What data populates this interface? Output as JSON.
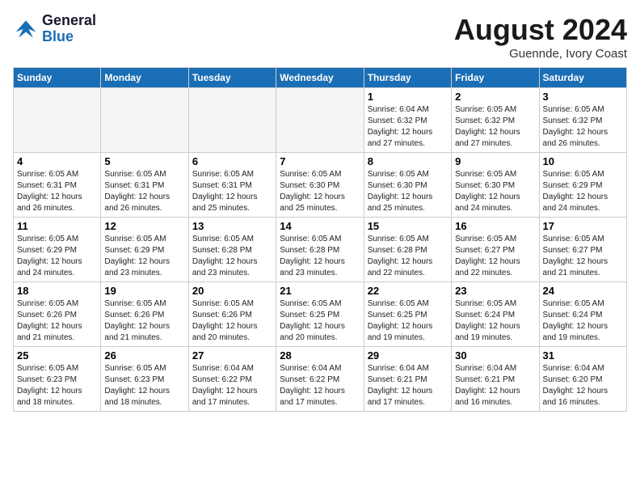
{
  "header": {
    "logo_line1": "General",
    "logo_line2": "Blue",
    "month": "August 2024",
    "location": "Guennde, Ivory Coast"
  },
  "weekdays": [
    "Sunday",
    "Monday",
    "Tuesday",
    "Wednesday",
    "Thursday",
    "Friday",
    "Saturday"
  ],
  "weeks": [
    [
      {
        "day": "",
        "info": ""
      },
      {
        "day": "",
        "info": ""
      },
      {
        "day": "",
        "info": ""
      },
      {
        "day": "",
        "info": ""
      },
      {
        "day": "1",
        "info": "Sunrise: 6:04 AM\nSunset: 6:32 PM\nDaylight: 12 hours\nand 27 minutes."
      },
      {
        "day": "2",
        "info": "Sunrise: 6:05 AM\nSunset: 6:32 PM\nDaylight: 12 hours\nand 27 minutes."
      },
      {
        "day": "3",
        "info": "Sunrise: 6:05 AM\nSunset: 6:32 PM\nDaylight: 12 hours\nand 26 minutes."
      }
    ],
    [
      {
        "day": "4",
        "info": "Sunrise: 6:05 AM\nSunset: 6:31 PM\nDaylight: 12 hours\nand 26 minutes."
      },
      {
        "day": "5",
        "info": "Sunrise: 6:05 AM\nSunset: 6:31 PM\nDaylight: 12 hours\nand 26 minutes."
      },
      {
        "day": "6",
        "info": "Sunrise: 6:05 AM\nSunset: 6:31 PM\nDaylight: 12 hours\nand 25 minutes."
      },
      {
        "day": "7",
        "info": "Sunrise: 6:05 AM\nSunset: 6:30 PM\nDaylight: 12 hours\nand 25 minutes."
      },
      {
        "day": "8",
        "info": "Sunrise: 6:05 AM\nSunset: 6:30 PM\nDaylight: 12 hours\nand 25 minutes."
      },
      {
        "day": "9",
        "info": "Sunrise: 6:05 AM\nSunset: 6:30 PM\nDaylight: 12 hours\nand 24 minutes."
      },
      {
        "day": "10",
        "info": "Sunrise: 6:05 AM\nSunset: 6:29 PM\nDaylight: 12 hours\nand 24 minutes."
      }
    ],
    [
      {
        "day": "11",
        "info": "Sunrise: 6:05 AM\nSunset: 6:29 PM\nDaylight: 12 hours\nand 24 minutes."
      },
      {
        "day": "12",
        "info": "Sunrise: 6:05 AM\nSunset: 6:29 PM\nDaylight: 12 hours\nand 23 minutes."
      },
      {
        "day": "13",
        "info": "Sunrise: 6:05 AM\nSunset: 6:28 PM\nDaylight: 12 hours\nand 23 minutes."
      },
      {
        "day": "14",
        "info": "Sunrise: 6:05 AM\nSunset: 6:28 PM\nDaylight: 12 hours\nand 23 minutes."
      },
      {
        "day": "15",
        "info": "Sunrise: 6:05 AM\nSunset: 6:28 PM\nDaylight: 12 hours\nand 22 minutes."
      },
      {
        "day": "16",
        "info": "Sunrise: 6:05 AM\nSunset: 6:27 PM\nDaylight: 12 hours\nand 22 minutes."
      },
      {
        "day": "17",
        "info": "Sunrise: 6:05 AM\nSunset: 6:27 PM\nDaylight: 12 hours\nand 21 minutes."
      }
    ],
    [
      {
        "day": "18",
        "info": "Sunrise: 6:05 AM\nSunset: 6:26 PM\nDaylight: 12 hours\nand 21 minutes."
      },
      {
        "day": "19",
        "info": "Sunrise: 6:05 AM\nSunset: 6:26 PM\nDaylight: 12 hours\nand 21 minutes."
      },
      {
        "day": "20",
        "info": "Sunrise: 6:05 AM\nSunset: 6:26 PM\nDaylight: 12 hours\nand 20 minutes."
      },
      {
        "day": "21",
        "info": "Sunrise: 6:05 AM\nSunset: 6:25 PM\nDaylight: 12 hours\nand 20 minutes."
      },
      {
        "day": "22",
        "info": "Sunrise: 6:05 AM\nSunset: 6:25 PM\nDaylight: 12 hours\nand 19 minutes."
      },
      {
        "day": "23",
        "info": "Sunrise: 6:05 AM\nSunset: 6:24 PM\nDaylight: 12 hours\nand 19 minutes."
      },
      {
        "day": "24",
        "info": "Sunrise: 6:05 AM\nSunset: 6:24 PM\nDaylight: 12 hours\nand 19 minutes."
      }
    ],
    [
      {
        "day": "25",
        "info": "Sunrise: 6:05 AM\nSunset: 6:23 PM\nDaylight: 12 hours\nand 18 minutes."
      },
      {
        "day": "26",
        "info": "Sunrise: 6:05 AM\nSunset: 6:23 PM\nDaylight: 12 hours\nand 18 minutes."
      },
      {
        "day": "27",
        "info": "Sunrise: 6:04 AM\nSunset: 6:22 PM\nDaylight: 12 hours\nand 17 minutes."
      },
      {
        "day": "28",
        "info": "Sunrise: 6:04 AM\nSunset: 6:22 PM\nDaylight: 12 hours\nand 17 minutes."
      },
      {
        "day": "29",
        "info": "Sunrise: 6:04 AM\nSunset: 6:21 PM\nDaylight: 12 hours\nand 17 minutes."
      },
      {
        "day": "30",
        "info": "Sunrise: 6:04 AM\nSunset: 6:21 PM\nDaylight: 12 hours\nand 16 minutes."
      },
      {
        "day": "31",
        "info": "Sunrise: 6:04 AM\nSunset: 6:20 PM\nDaylight: 12 hours\nand 16 minutes."
      }
    ]
  ]
}
